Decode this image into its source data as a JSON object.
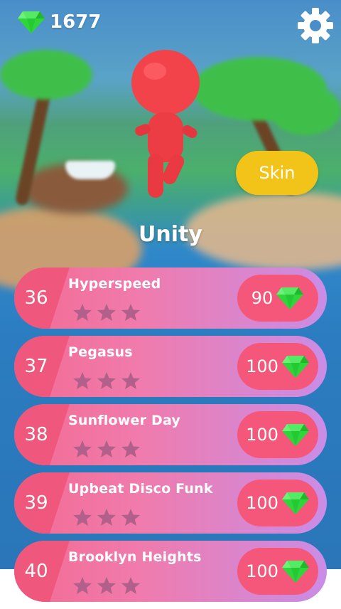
{
  "header": {
    "gem_count": "1677",
    "gem_icon": "gem-icon",
    "settings_icon": "gear-icon"
  },
  "character": {
    "name": "Unity",
    "skin_label": "Skin"
  },
  "colors": {
    "row_left": "#f0577c",
    "row_gradient_start": "#f36b93",
    "row_gradient_end": "#c98de6",
    "price_pill": "#f5577b",
    "skin_button": "#f2c318",
    "gem": "#2ed63a",
    "star_empty": "#b0608a"
  },
  "songs": [
    {
      "number": "36",
      "title": "Hyperspeed",
      "price": "90",
      "stars_filled": 0,
      "stars_total": 3
    },
    {
      "number": "37",
      "title": "Pegasus",
      "price": "100",
      "stars_filled": 0,
      "stars_total": 3
    },
    {
      "number": "38",
      "title": "Sunflower Day",
      "price": "100",
      "stars_filled": 0,
      "stars_total": 3
    },
    {
      "number": "39",
      "title": "Upbeat Disco Funk",
      "price": "100",
      "stars_filled": 0,
      "stars_total": 3
    },
    {
      "number": "40",
      "title": "Brooklyn Heights",
      "price": "100",
      "stars_filled": 0,
      "stars_total": 3
    }
  ]
}
